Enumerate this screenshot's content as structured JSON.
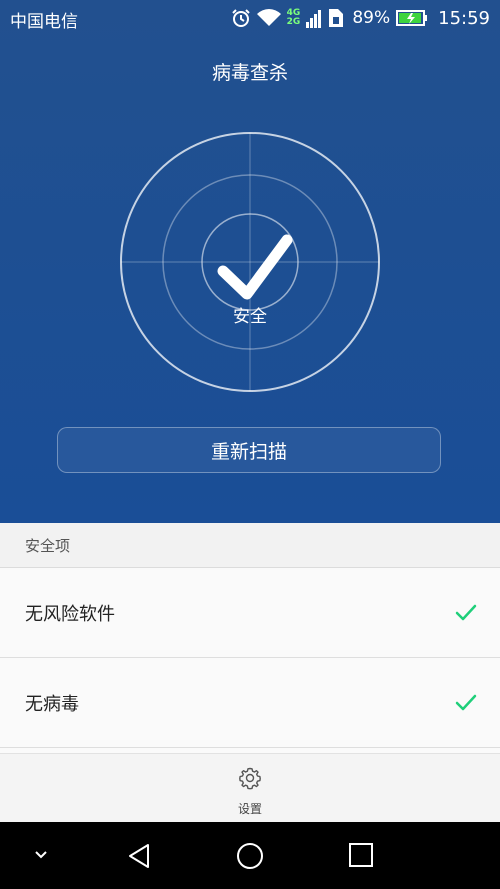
{
  "status_bar": {
    "carrier": "中国电信",
    "network_top": "4G",
    "network_bottom": "2G",
    "battery": "89%",
    "time": "15:59"
  },
  "header": {
    "title": "病毒查杀"
  },
  "scan": {
    "status": "安全",
    "rescan_label": "重新扫描"
  },
  "list": {
    "section_title": "安全项",
    "items": [
      {
        "label": "无风险软件"
      },
      {
        "label": "无病毒"
      }
    ]
  },
  "bottom": {
    "settings_label": "设置"
  },
  "colors": {
    "accent_green": "#1fcf7a",
    "background_blue": "#1f4f8e"
  }
}
